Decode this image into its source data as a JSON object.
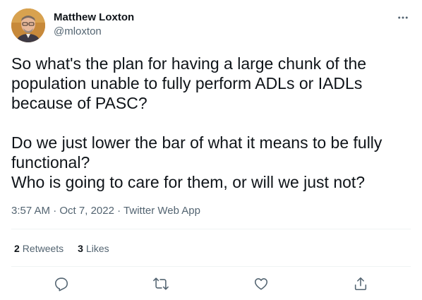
{
  "author": {
    "display_name": "Matthew Loxton",
    "handle": "@mloxton"
  },
  "tweet": {
    "text": "So what's the plan for having a large chunk of the population unable to fully perform ADLs or IADLs because of PASC?\n\nDo we just lower the bar of what it means to be fully functional?\nWho is going to care for them, or will we just not?",
    "time": "3:57 AM",
    "separator": "·",
    "date": "Oct 7, 2022",
    "source": "Twitter Web App"
  },
  "stats": {
    "retweets_count": "2",
    "retweets_label": "Retweets",
    "likes_count": "3",
    "likes_label": "Likes"
  },
  "icons": {
    "more": "more-horizontal-icon",
    "reply": "reply-icon",
    "retweet": "retweet-icon",
    "like": "heart-icon",
    "share": "share-icon"
  },
  "colors": {
    "text_primary": "#0f1419",
    "text_secondary": "#536471",
    "divider": "#eff3f4"
  }
}
